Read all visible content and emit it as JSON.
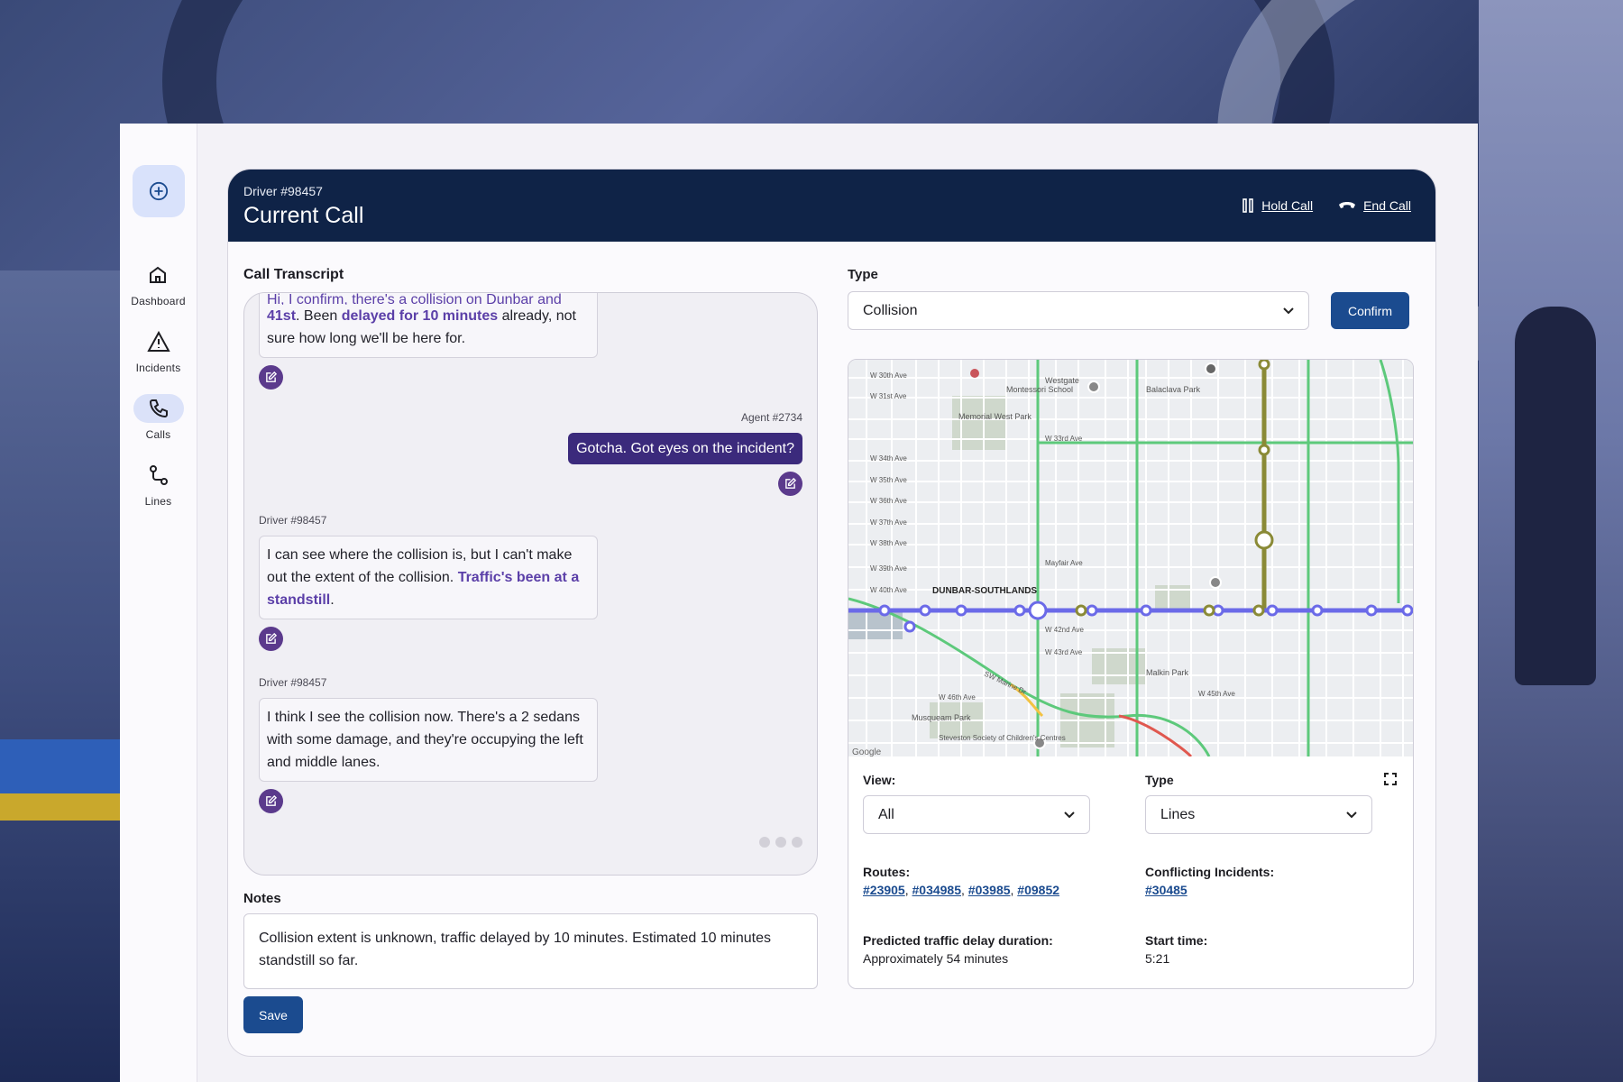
{
  "sidebar": {
    "items": [
      {
        "label": "Dashboard",
        "icon": "home-icon"
      },
      {
        "label": "Incidents",
        "icon": "warning-icon"
      },
      {
        "label": "Calls",
        "icon": "phone-icon"
      },
      {
        "label": "Lines",
        "icon": "route-icon"
      }
    ]
  },
  "header": {
    "driver": "Driver #98457",
    "title": "Current Call",
    "hold_label": "Hold Call",
    "end_label": "End Call"
  },
  "transcript": {
    "label": "Call Transcript",
    "first_msg": {
      "partial_top": "Hi, I confirm, there's a collision on Dunbar and",
      "bold1": "41st",
      "t1": ". Been ",
      "bold2": "delayed for 10 minutes",
      "t2": " already, not sure how long we'll be here for."
    },
    "agent_msg": {
      "who": "Agent #2734",
      "text": "Gotcha. Got eyes on the incident?"
    },
    "msg2": {
      "who": "Driver #98457",
      "text": "I can see where the collision is, but I can't make out the extent of the collision. ",
      "bold": "Traffic's been at a standstill",
      "end": "."
    },
    "msg3": {
      "who": "Driver #98457",
      "text": "I think I see the collision now. There's a 2 sedans with some damage, and they're occupying the left and middle lanes."
    }
  },
  "notes": {
    "label": "Notes",
    "value": "Collision extent is unknown, traffic delayed by 10 minutes. Estimated 10 minutes standstill so far.",
    "save_label": "Save"
  },
  "type_select": {
    "label": "Type",
    "value": "Collision",
    "confirm_label": "Confirm"
  },
  "map": {
    "street_labels": [
      "W 30th Ave",
      "W 31st Ave",
      "Westgate",
      "Montessori School",
      "Balaclava Park",
      "Memorial West Park",
      "W 33rd Ave",
      "W 34th Ave",
      "W 35th Ave",
      "W 36th Ave",
      "W 37th Ave",
      "W 38th Ave",
      "W 39th Ave",
      "W 40th Ave",
      "DUNBAR-SOUTHLANDS",
      "W 42nd Ave",
      "W 43rd Ave",
      "Malkin Park",
      "W 45th Ave",
      "W 46th Ave",
      "Musqueam Park",
      "Steveston Society of Children's Centres",
      "SW Marine Dr",
      "Mayfair Ave",
      "Google"
    ],
    "view_label": "View:",
    "view_value": "All",
    "type_label": "Type",
    "type_value": "Lines",
    "routes_label": "Routes:",
    "routes": [
      "#23905",
      "#034985",
      "#03985",
      "#09852"
    ],
    "conflicts_label": "Conflicting Incidents:",
    "conflicts": "#30485",
    "delay_label": "Predicted traffic delay duration:",
    "delay_value": "Approximately 54 minutes",
    "start_label": "Start time:",
    "start_value": "5:21"
  },
  "colors": {
    "navy": "#0f2347",
    "primary": "#1b4b8f",
    "accent_purple": "#5b3fa8",
    "route_line": "#6b6ae8"
  }
}
